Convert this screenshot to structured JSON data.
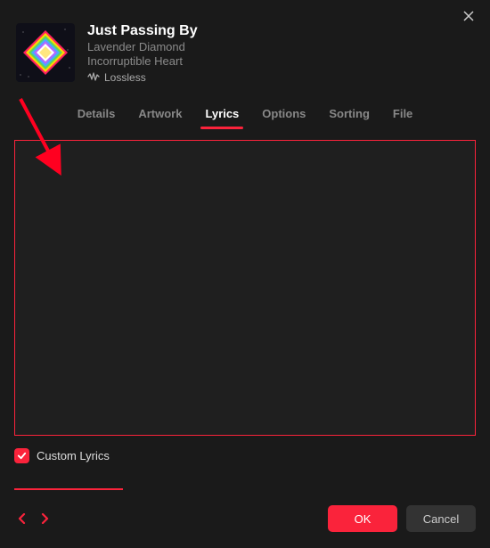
{
  "track": {
    "title": "Just Passing By",
    "artist": "Lavender Diamond",
    "album": "Incorruptible Heart",
    "lossless": "Lossless"
  },
  "tabs": {
    "details": "Details",
    "artwork": "Artwork",
    "lyrics": "Lyrics",
    "options": "Options",
    "sorting": "Sorting",
    "file": "File"
  },
  "lyrics": {
    "content": "",
    "custom_label": "Custom Lyrics"
  },
  "buttons": {
    "ok": "OK",
    "cancel": "Cancel"
  }
}
